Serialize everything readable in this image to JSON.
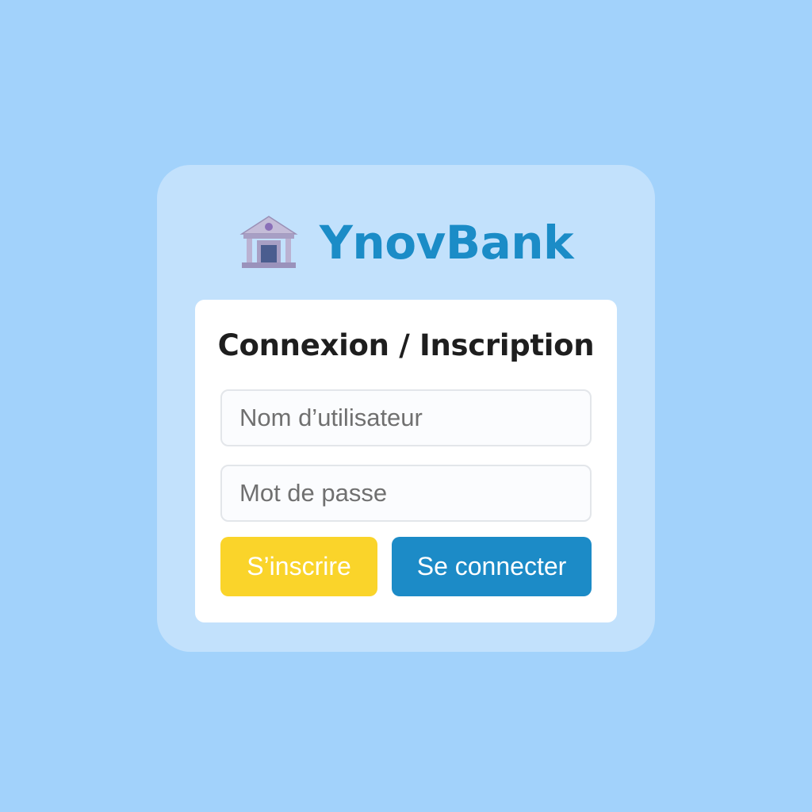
{
  "brand": {
    "name": "YnovBank",
    "icon": "bank-building-icon",
    "color": "#1b8cc7"
  },
  "form": {
    "title": "Connexion / Inscription",
    "username_placeholder": "Nom d’utilisateur",
    "username_value": "",
    "password_placeholder": "Mot de passe",
    "password_value": ""
  },
  "actions": {
    "register_label": "S’inscrire",
    "login_label": "Se connecter"
  },
  "colors": {
    "background": "#a2d2fb",
    "outer_card": "#c2e1fc",
    "register_button": "#fad42a",
    "login_button": "#1c8bc7"
  }
}
